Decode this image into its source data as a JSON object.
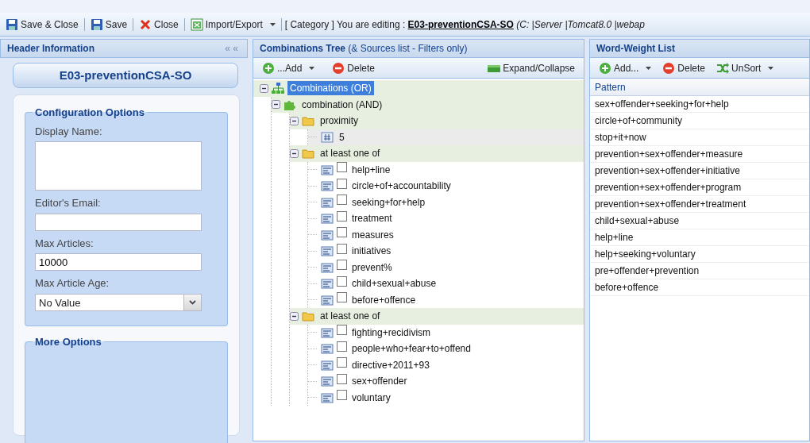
{
  "toolbar": {
    "buttons": [
      {
        "label": "Save & Close",
        "kind": "save"
      },
      {
        "label": "Save",
        "kind": "save"
      },
      {
        "label": "Close",
        "kind": "close"
      },
      {
        "label": "Import/Export",
        "kind": "import",
        "menu": true
      }
    ],
    "editing": "[ Category ] You are editing : **E03-preventionCSA-SO** *(C: |Server |Tomcat8.0 |webap*"
  },
  "header_panel": {
    "title": "Header Information",
    "collapse": "« «",
    "name_button": "E03-preventionCSA-SO",
    "config": {
      "legend": "Configuration Options",
      "fields": [
        {
          "label": "Display Name:",
          "kind": "textarea"
        },
        {
          "label": "Editor's Email:",
          "kind": "text"
        },
        {
          "label": "Max Articles:",
          "kind": "text",
          "value": "10000"
        },
        {
          "label": "Max Article Age:",
          "kind": "select",
          "value": "No Value"
        }
      ]
    },
    "more": {
      "legend": "More Options"
    }
  },
  "tree_panel": {
    "title": "**Combinations Tree** (& Sources list - Filters only)",
    "toolbar": [
      {
        "label": "...Add",
        "kind": "add",
        "menu": true
      },
      {
        "label": "Delete",
        "kind": "delete",
        "menu": false
      },
      {
        "label": "Expand/Collapse",
        "kind": "expand",
        "menu": false
      }
    ],
    "tree": [
      {
        "label": "Combinations (OR)",
        "kind": "root",
        "expanded": true,
        "selected": true,
        "children": [
          {
            "label": "combination (AND)",
            "kind": "combination",
            "expanded": true,
            "selected": false,
            "children": [
              {
                "label": "proximity",
                "kind": "group",
                "expanded": true,
                "selected": false,
                "children": [
                  {
                    "label": "5",
                    "kind": "value",
                    "selected": false
                  }
                ]
              },
              {
                "label": "at least one of",
                "kind": "group",
                "expanded": true,
                "selected": false,
                "children": [
                  {
                    "label": "help+line",
                    "kind": "term",
                    "checked": false,
                    "selected": false
                  },
                  {
                    "label": "circle+of+accountability",
                    "kind": "term",
                    "checked": false,
                    "selected": false
                  },
                  {
                    "label": "seeking+for+help",
                    "kind": "term",
                    "checked": false,
                    "selected": false
                  },
                  {
                    "label": "treatment",
                    "kind": "term",
                    "checked": false,
                    "selected": false
                  },
                  {
                    "label": "measures",
                    "kind": "term",
                    "checked": false,
                    "selected": false
                  },
                  {
                    "label": "initiatives",
                    "kind": "term",
                    "checked": false,
                    "selected": false
                  },
                  {
                    "label": "prevent%",
                    "kind": "term",
                    "checked": false,
                    "selected": false
                  },
                  {
                    "label": "child+sexual+abuse",
                    "kind": "term",
                    "checked": false,
                    "selected": false
                  },
                  {
                    "label": "before+offence",
                    "kind": "term",
                    "checked": false,
                    "selected": false
                  }
                ]
              },
              {
                "label": "at least one of",
                "kind": "group",
                "expanded": true,
                "selected": false,
                "children": [
                  {
                    "label": "fighting+recidivism",
                    "kind": "term",
                    "checked": false,
                    "selected": false
                  },
                  {
                    "label": "people+who+fear+to+offend",
                    "kind": "term",
                    "checked": false,
                    "selected": false
                  },
                  {
                    "label": "directive+2011+93",
                    "kind": "term",
                    "checked": false,
                    "selected": false
                  },
                  {
                    "label": "sex+offender",
                    "kind": "term",
                    "checked": false,
                    "selected": false
                  },
                  {
                    "label": "voluntary",
                    "kind": "term",
                    "checked": false,
                    "selected": false
                  }
                ]
              }
            ]
          }
        ]
      }
    ]
  },
  "word_panel": {
    "title": "Word-Weight List",
    "toolbar": [
      {
        "label": "Add...",
        "kind": "add",
        "menu": true
      },
      {
        "label": "Delete",
        "kind": "delete",
        "menu": false
      },
      {
        "label": "UnSort",
        "kind": "unsort",
        "menu": true
      }
    ],
    "columns": [
      "Pattern"
    ],
    "rows": [
      "sex+offender+seeking+for+help",
      "circle+of+community",
      "stop+it+now",
      "prevention+sex+offender+measure",
      "prevention+sex+offender+initiative",
      "prevention+sex+offender+program",
      "prevention+sex+offender+treatment",
      "child+sexual+abuse",
      "help+line",
      "help+seeking+voluntary",
      "pre+offender+prevention",
      "before+offence"
    ]
  }
}
